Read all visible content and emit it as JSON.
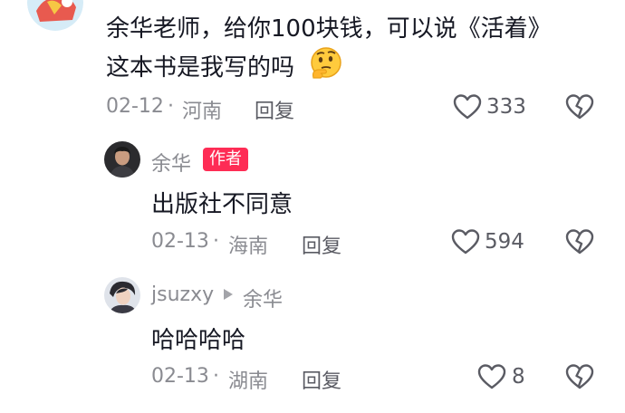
{
  "comment": {
    "line1": "余华老师，给你100块钱，可以说《活着》",
    "line2": "这本书是我写的吗",
    "emoji": "thinking-face",
    "date": "02-12",
    "location": "河南",
    "reply_label": "回复",
    "like_count": "333"
  },
  "replies": [
    {
      "author": "余华",
      "badge": "作者",
      "text": "出版社不同意",
      "date": "02-13",
      "location": "海南",
      "reply_label": "回复",
      "like_count": "594"
    },
    {
      "author": "jsuzxy",
      "reply_to": "余华",
      "text": "哈哈哈哈",
      "date": "02-13",
      "location": "湖南",
      "reply_label": "回复",
      "like_count": "8"
    }
  ],
  "separator": "·",
  "icons": {
    "like": "heart-outline-icon",
    "dislike": "broken-heart-icon",
    "reply_arrow": "play-triangle-icon"
  },
  "colors": {
    "badge": "#fe2c55",
    "meta_text": "#8a8b91",
    "body_text": "#161823"
  }
}
